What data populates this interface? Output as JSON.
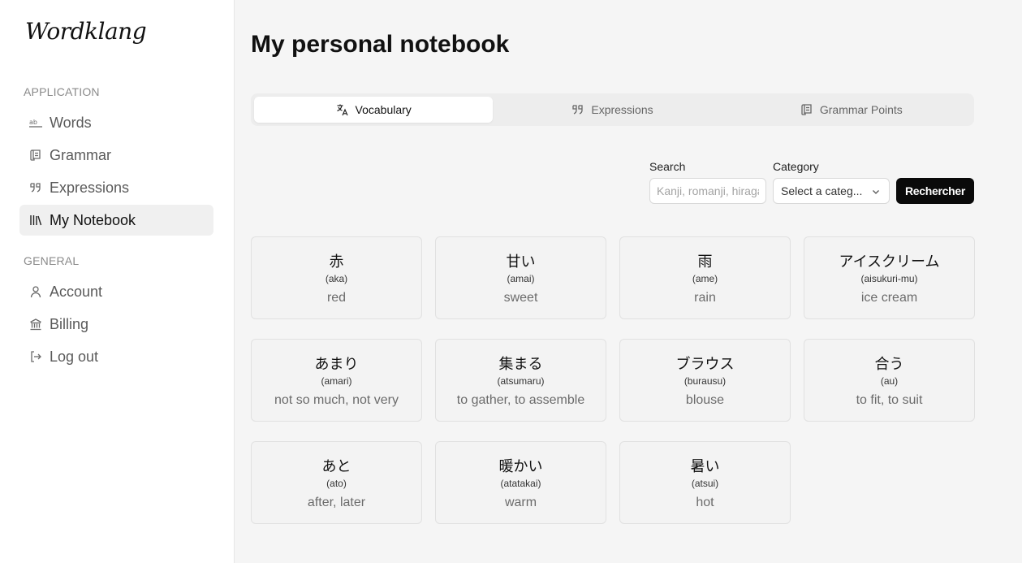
{
  "app": {
    "logo": "Wordklang"
  },
  "sidebar": {
    "sections": [
      {
        "title": "APPLICATION",
        "items": [
          {
            "label": "Words",
            "icon": "ab-text-icon"
          },
          {
            "label": "Grammar",
            "icon": "scroll-icon"
          },
          {
            "label": "Expressions",
            "icon": "quote-icon"
          },
          {
            "label": "My Notebook",
            "icon": "library-icon",
            "active": true
          }
        ]
      },
      {
        "title": "GENERAL",
        "items": [
          {
            "label": "Account",
            "icon": "user-icon"
          },
          {
            "label": "Billing",
            "icon": "bank-icon"
          },
          {
            "label": "Log out",
            "icon": "logout-icon"
          }
        ]
      }
    ]
  },
  "main": {
    "title": "My personal notebook",
    "tabs": [
      {
        "label": "Vocabulary",
        "icon": "translate-icon",
        "active": true
      },
      {
        "label": "Expressions",
        "icon": "quote-icon"
      },
      {
        "label": "Grammar Points",
        "icon": "scroll-icon"
      }
    ],
    "filters": {
      "search_label": "Search",
      "search_placeholder": "Kanji, romanji, hiragana",
      "category_label": "Category",
      "category_value": "Select a categ...",
      "button_label": "Rechercher"
    },
    "cards": [
      {
        "jp": "赤",
        "romaji": "(aka)",
        "meaning": "red"
      },
      {
        "jp": "甘い",
        "romaji": "(amai)",
        "meaning": "sweet"
      },
      {
        "jp": "雨",
        "romaji": "(ame)",
        "meaning": "rain"
      },
      {
        "jp": "アイスクリーム",
        "romaji": "(aisukuri-mu)",
        "meaning": "ice cream"
      },
      {
        "jp": "あまり",
        "romaji": "(amari)",
        "meaning": "not so much, not very"
      },
      {
        "jp": "集まる",
        "romaji": "(atsumaru)",
        "meaning": "to gather, to assemble"
      },
      {
        "jp": "ブラウス",
        "romaji": "(burausu)",
        "meaning": "blouse"
      },
      {
        "jp": "合う",
        "romaji": "(au)",
        "meaning": "to fit, to suit"
      },
      {
        "jp": "あと",
        "romaji": "(ato)",
        "meaning": "after, later"
      },
      {
        "jp": "暖かい",
        "romaji": "(atatakai)",
        "meaning": "warm"
      },
      {
        "jp": "暑い",
        "romaji": "(atsui)",
        "meaning": "hot"
      }
    ]
  }
}
